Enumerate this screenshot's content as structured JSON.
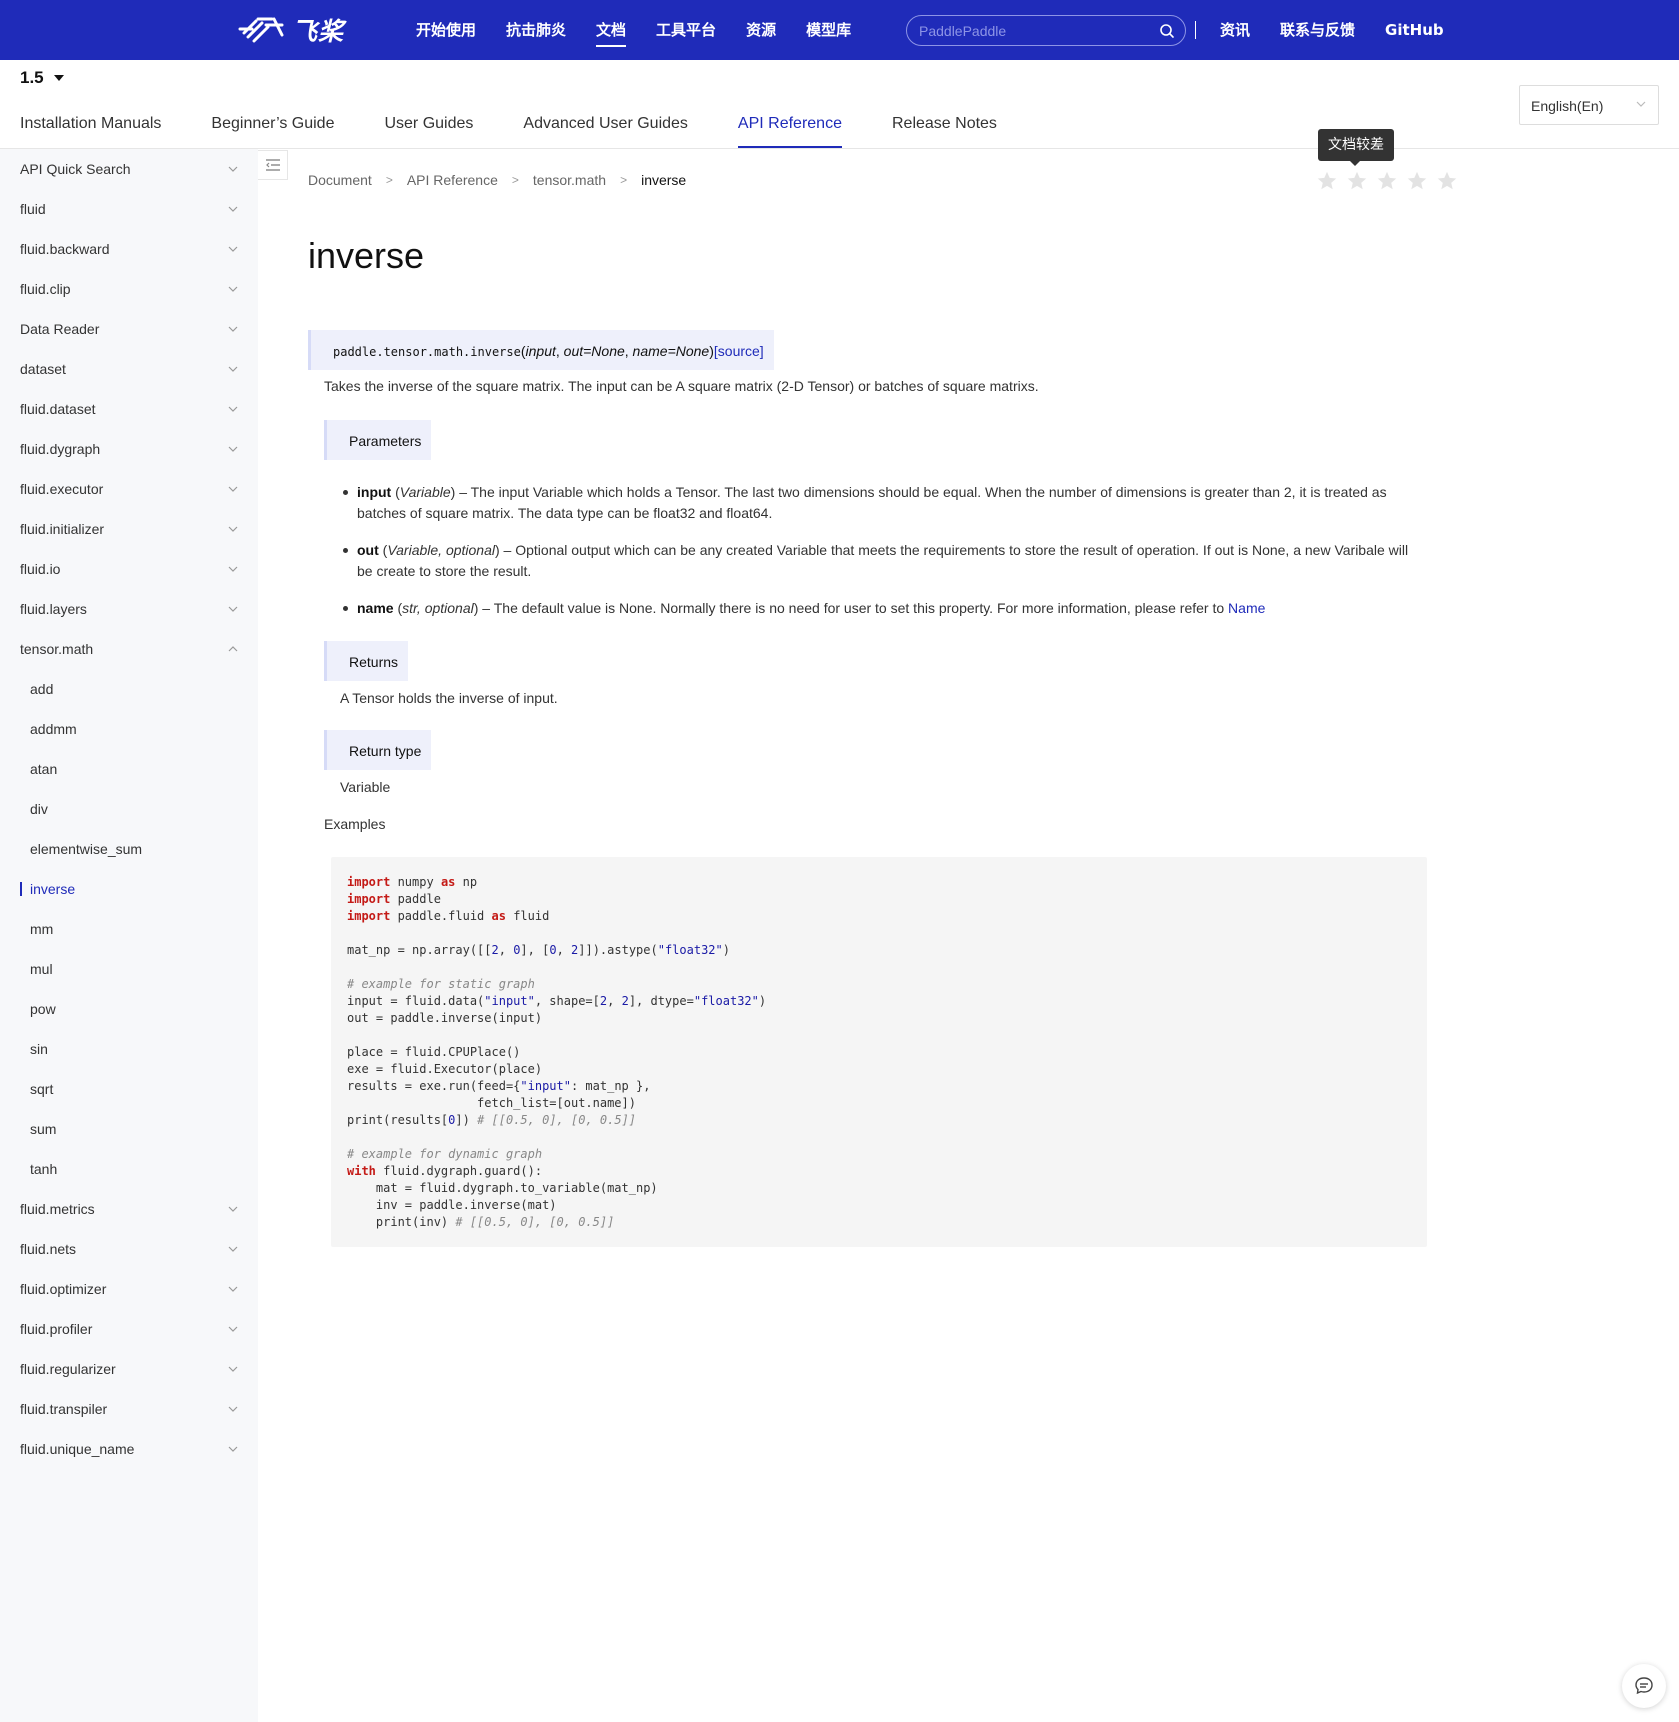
{
  "header": {
    "logo_text": "飞桨",
    "nav": [
      "开始使用",
      "抗击肺炎",
      "文档",
      "工具平台",
      "资源",
      "模型库"
    ],
    "nav_active": "文档",
    "search_placeholder": "PaddlePaddle",
    "links": [
      "资讯",
      "联系与反馈",
      "GitHub"
    ]
  },
  "version": "1.5",
  "tabs": [
    "Installation Manuals",
    "Beginner’s Guide",
    "User Guides",
    "Advanced User Guides",
    "API Reference",
    "Release Notes"
  ],
  "active_tab": "API Reference",
  "language": "English(En)",
  "sidebar": {
    "items": [
      {
        "label": "API Quick Search",
        "expandable": true
      },
      {
        "label": "fluid",
        "expandable": true
      },
      {
        "label": "fluid.backward",
        "expandable": true
      },
      {
        "label": "fluid.clip",
        "expandable": true
      },
      {
        "label": "Data Reader",
        "expandable": true
      },
      {
        "label": "dataset",
        "expandable": true
      },
      {
        "label": "fluid.dataset",
        "expandable": true
      },
      {
        "label": "fluid.dygraph",
        "expandable": true
      },
      {
        "label": "fluid.executor",
        "expandable": true
      },
      {
        "label": "fluid.initializer",
        "expandable": true
      },
      {
        "label": "fluid.io",
        "expandable": true
      },
      {
        "label": "fluid.layers",
        "expandable": true
      },
      {
        "label": "tensor.math",
        "expandable": true,
        "expanded": true
      },
      {
        "label": "add",
        "sub": true
      },
      {
        "label": "addmm",
        "sub": true
      },
      {
        "label": "atan",
        "sub": true
      },
      {
        "label": "div",
        "sub": true
      },
      {
        "label": "elementwise_sum",
        "sub": true
      },
      {
        "label": "inverse",
        "sub": true,
        "active": true
      },
      {
        "label": "mm",
        "sub": true
      },
      {
        "label": "mul",
        "sub": true
      },
      {
        "label": "pow",
        "sub": true
      },
      {
        "label": "sin",
        "sub": true
      },
      {
        "label": "sqrt",
        "sub": true
      },
      {
        "label": "sum",
        "sub": true
      },
      {
        "label": "tanh",
        "sub": true
      },
      {
        "label": "fluid.metrics",
        "expandable": true
      },
      {
        "label": "fluid.nets",
        "expandable": true
      },
      {
        "label": "fluid.optimizer",
        "expandable": true
      },
      {
        "label": "fluid.profiler",
        "expandable": true
      },
      {
        "label": "fluid.regularizer",
        "expandable": true
      },
      {
        "label": "fluid.transpiler",
        "expandable": true
      },
      {
        "label": "fluid.unique_name",
        "expandable": true
      }
    ]
  },
  "breadcrumb": [
    "Document",
    "API Reference",
    "tensor.math",
    "inverse"
  ],
  "rating": {
    "tooltip": "文档较差",
    "stars": 5,
    "value": 0
  },
  "page": {
    "title": "inverse",
    "signature": {
      "prefix": "paddle.tensor.math.inverse",
      "open": "(",
      "arg1": "input",
      "sep1": ", ",
      "arg2": "out=None",
      "sep2": ", ",
      "arg3": "name=None",
      "close": ")",
      "source": "[source]"
    },
    "description": "Takes the inverse of the square matrix. The input can be A square matrix (2-D Tensor) or batches of square matrixs.",
    "parameters_label": "Parameters",
    "params": [
      {
        "name": "input",
        "type": "Variable",
        "text": " – The input Variable which holds a Tensor. The last two dimensions should be equal. When the number of dimensions is greater than 2, it is treated as batches of square matrix. The data type can be float32 and float64."
      },
      {
        "name": "out",
        "type": "Variable, optional",
        "text": " – Optional output which can be any created Variable that meets the requirements to store the result of operation. If out is None, a new Varibale will be create to store the result."
      },
      {
        "name": "name",
        "type": "str, optional",
        "text": " – The default value is None. Normally there is no need for user to set this property. For more information, please refer to ",
        "link": "Name"
      }
    ],
    "returns_label": "Returns",
    "returns": "A Tensor holds the inverse of input.",
    "return_type_label": "Return type",
    "return_type": "Variable",
    "examples_label": "Examples"
  },
  "code_lines": [
    "import numpy as np",
    "import paddle",
    "import paddle.fluid as fluid",
    "",
    "mat_np = np.array([[2, 0], [0, 2]]).astype(\"float32\")",
    "",
    "# example for static graph",
    "input = fluid.data(\"input\", shape=[2, 2], dtype=\"float32\")",
    "out = paddle.inverse(input)",
    "",
    "place = fluid.CPUPlace()",
    "exe = fluid.Executor(place)",
    "results = exe.run(feed={\"input\": mat_np },",
    "                  fetch_list=[out.name])",
    "print(results[0]) # [[0.5, 0], [0, 0.5]]",
    "",
    "# example for dynamic graph",
    "with fluid.dygraph.guard():",
    "    mat = fluid.dygraph.to_variable(mat_np)",
    "    inv = paddle.inverse(mat)",
    "    print(inv) # [[0.5, 0], [0, 0.5]]"
  ]
}
